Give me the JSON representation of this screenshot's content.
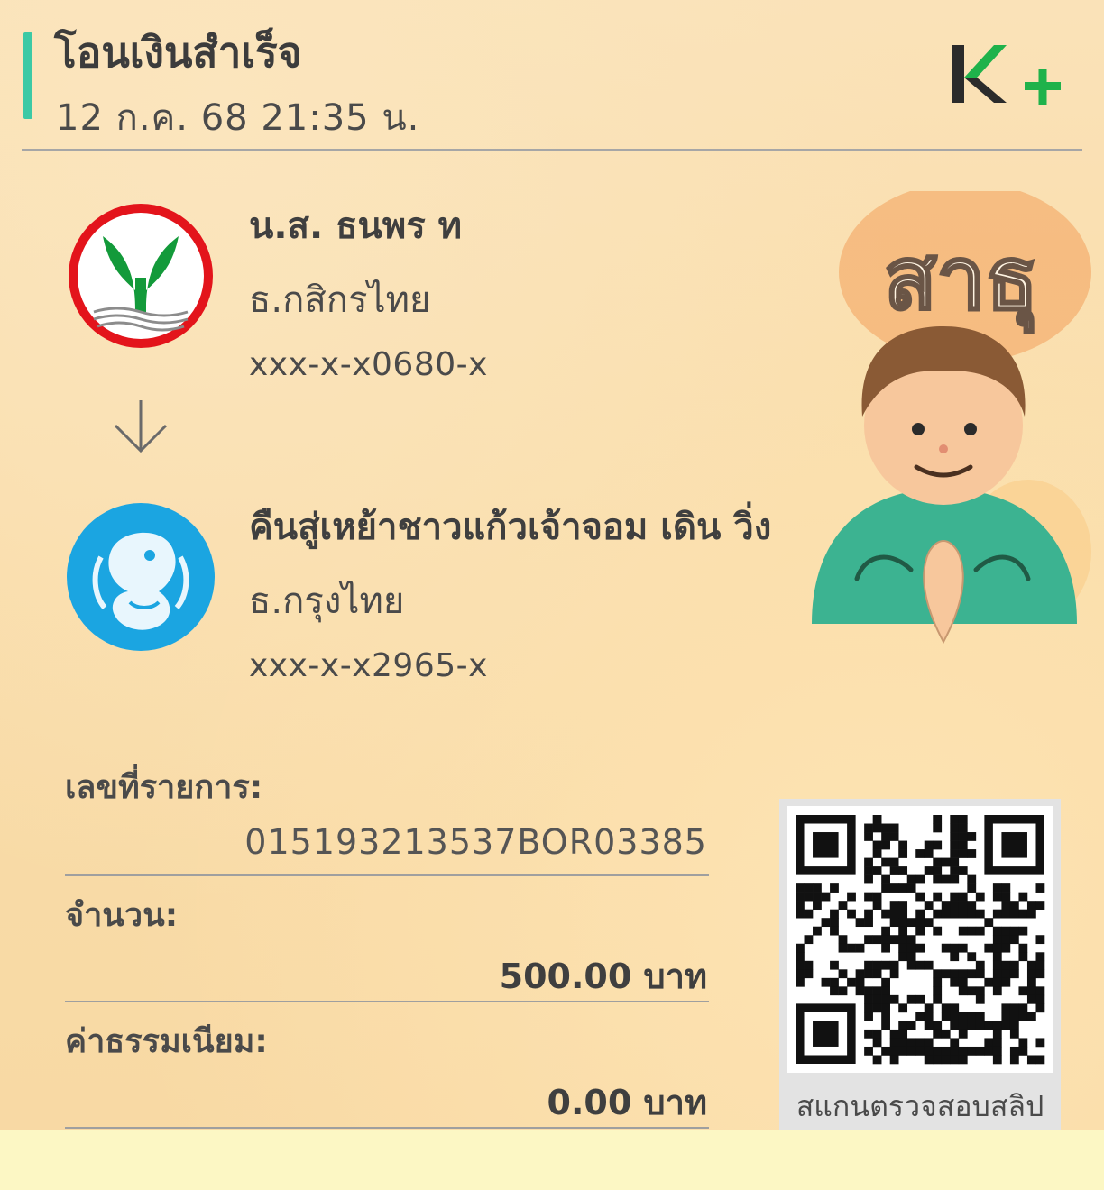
{
  "header": {
    "title": "โอนเงินสำเร็จ",
    "datetime": "12 ก.ค. 68  21:35 น.",
    "brand_logo": "K+"
  },
  "sender": {
    "name": "น.ส. ธนพร ท",
    "bank": "ธ.กสิกรไทย",
    "account": "xxx-x-x0680-x",
    "logo_icon": "kasikorn-bank-logo"
  },
  "transfer_arrow_icon": "arrow-down-icon",
  "receiver": {
    "name": "คืนสู่เหย้าชาวแก้วเจ้าจอม เดิน วิ่ง",
    "bank": "ธ.กรุงไทย",
    "account": "xxx-x-x2965-x",
    "logo_icon": "krungthai-bank-logo"
  },
  "sticker": {
    "text": "สาธุ",
    "icon": "praying-boy-sticker"
  },
  "details": {
    "txid_label": "เลขที่รายการ:",
    "txid_value": "015193213537BOR03385",
    "amount_label": "จำนวน:",
    "amount_value": "500.00 บาท",
    "fee_label": "ค่าธรรมเนียม:",
    "fee_value": "0.00 บาท"
  },
  "qr": {
    "caption": "สแกนตรวจสอบสลิป",
    "icon": "qr-code"
  },
  "colors": {
    "accent": "#3cc9a5",
    "kplus_green": "#1fb24b",
    "kplus_dark": "#2b2b2b",
    "kbank_red": "#e3141b",
    "kbank_green": "#139a3a",
    "ktb_blue": "#1ba5e1"
  }
}
